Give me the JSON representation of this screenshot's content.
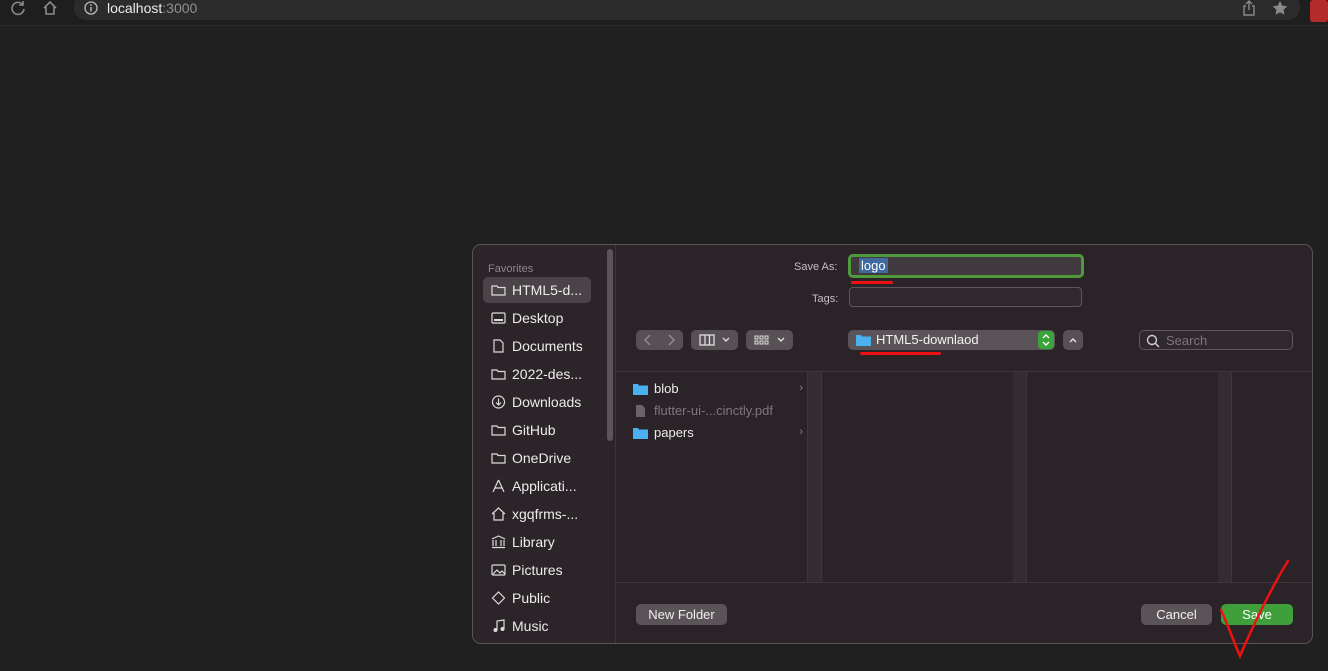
{
  "browser": {
    "url_host": "localhost",
    "url_port": ":3000"
  },
  "sidebar": {
    "section_title": "Favorites",
    "items": [
      {
        "label": "HTML5-d...",
        "icon": "folder-icon",
        "active": true
      },
      {
        "label": "Desktop",
        "icon": "desktop-icon"
      },
      {
        "label": "Documents",
        "icon": "document-icon"
      },
      {
        "label": "2022-des...",
        "icon": "folder-icon"
      },
      {
        "label": "Downloads",
        "icon": "download-icon"
      },
      {
        "label": "GitHub",
        "icon": "folder-icon"
      },
      {
        "label": "OneDrive",
        "icon": "folder-icon"
      },
      {
        "label": "Applicati...",
        "icon": "applications-icon"
      },
      {
        "label": "xgqfrms-...",
        "icon": "home-icon"
      },
      {
        "label": "Library",
        "icon": "library-icon"
      },
      {
        "label": "Pictures",
        "icon": "pictures-icon"
      },
      {
        "label": "Public",
        "icon": "public-icon"
      },
      {
        "label": "Music",
        "icon": "music-icon"
      }
    ]
  },
  "form": {
    "save_as_label": "Save As:",
    "save_as_value": "logo",
    "tags_label": "Tags:",
    "tags_value": ""
  },
  "toolbar": {
    "location": "HTML5-downlaod",
    "search_placeholder": "Search"
  },
  "files": [
    {
      "name": "blob",
      "type": "folder",
      "enabled": true
    },
    {
      "name": "flutter-ui-...cinctly.pdf",
      "type": "pdf",
      "enabled": false
    },
    {
      "name": "papers",
      "type": "folder",
      "enabled": true
    }
  ],
  "buttons": {
    "new_folder": "New Folder",
    "cancel": "Cancel",
    "save": "Save"
  },
  "colors": {
    "accent_green": "#3f9f3b",
    "annotation_red": "#e11111"
  }
}
